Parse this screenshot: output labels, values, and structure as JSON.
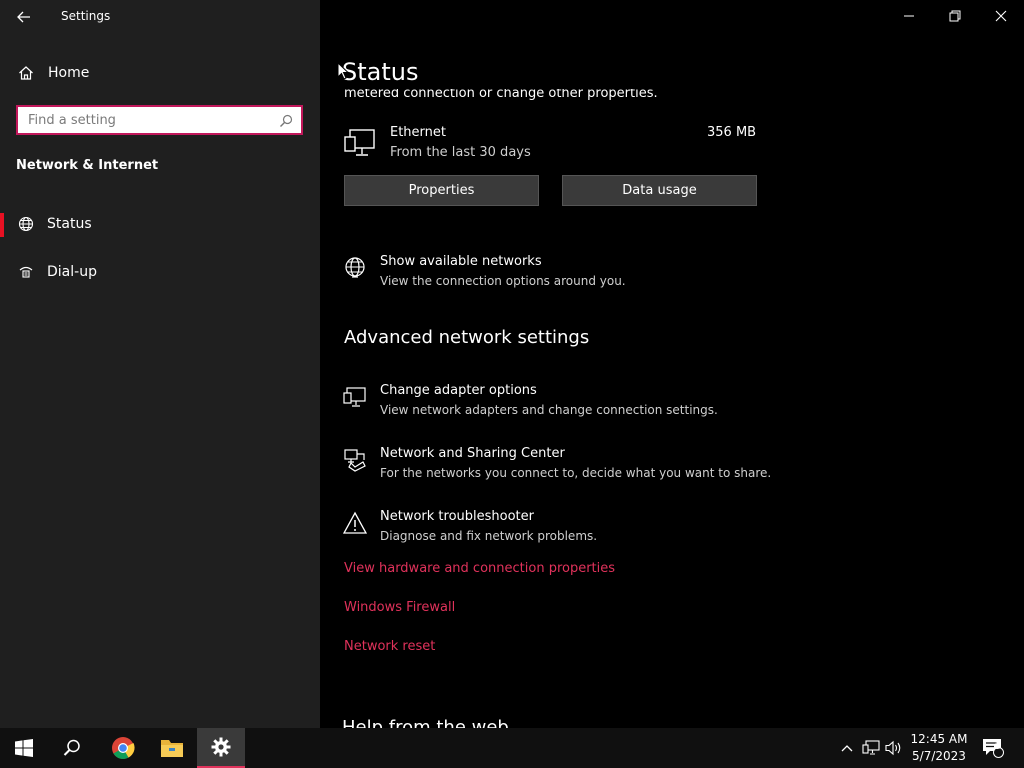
{
  "window": {
    "app_title": "Settings",
    "controls": {
      "minimize": "minimize",
      "restore": "restore",
      "close": "close"
    }
  },
  "sidebar": {
    "home_label": "Home",
    "search_placeholder": "Find a setting",
    "section_title": "Network & Internet",
    "items": [
      {
        "label": "Status",
        "icon": "globe-icon",
        "active": true
      },
      {
        "label": "Dial-up",
        "icon": "dialup-icon",
        "active": false
      }
    ]
  },
  "main": {
    "title": "Status",
    "cut_text": "metered connection or change other properties.",
    "connection": {
      "name": "Ethernet",
      "subtitle": "From the last 30 days",
      "usage": "356 MB"
    },
    "buttons": {
      "properties": "Properties",
      "data_usage": "Data usage"
    },
    "show_networks": {
      "title": "Show available networks",
      "subtitle": "View the connection options around you."
    },
    "advanced_heading": "Advanced network settings",
    "advanced_items": [
      {
        "title": "Change adapter options",
        "subtitle": "View network adapters and change connection settings.",
        "icon": "adapter-icon"
      },
      {
        "title": "Network and Sharing Center",
        "subtitle": "For the networks you connect to, decide what you want to share.",
        "icon": "sharing-icon"
      },
      {
        "title": "Network troubleshooter",
        "subtitle": "Diagnose and fix network problems.",
        "icon": "warning-icon"
      }
    ],
    "links": [
      "View hardware and connection properties",
      "Windows Firewall",
      "Network reset"
    ],
    "help_heading": "Help from the web"
  },
  "taskbar": {
    "time": "12:45 AM",
    "date": "5/7/2023",
    "notification_count": "1"
  },
  "colors": {
    "accent": "#e0325b",
    "sidebar_bg": "#1f1f1f",
    "main_bg": "#000000"
  }
}
